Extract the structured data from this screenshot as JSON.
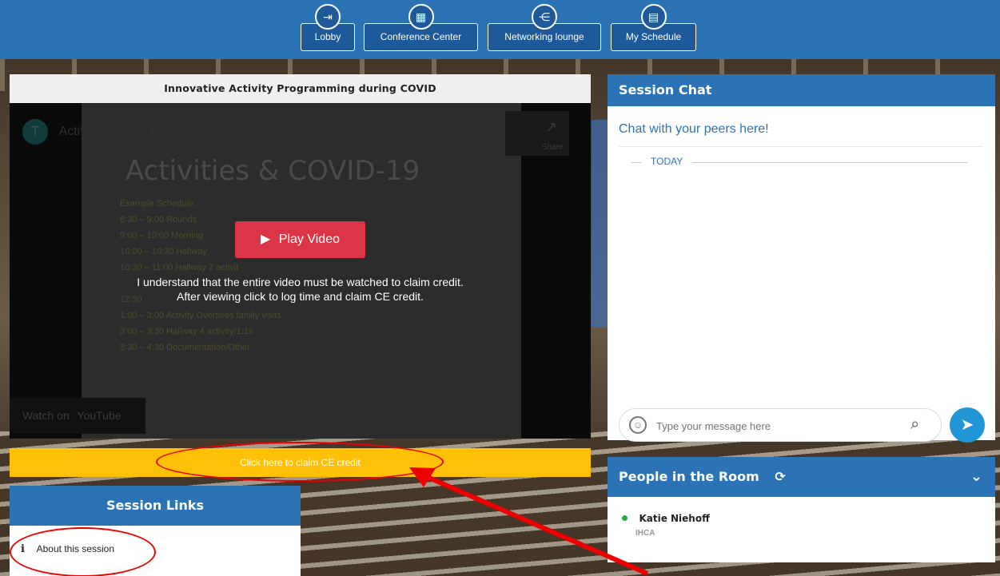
{
  "nav": {
    "items": [
      {
        "label": "Lobby",
        "icon": "sign-in-icon"
      },
      {
        "label": "Conference Center",
        "icon": "conference-icon"
      },
      {
        "label": "Networking lounge",
        "icon": "networking-icon"
      },
      {
        "label": "My Schedule",
        "icon": "calendar-icon"
      }
    ]
  },
  "video": {
    "title": "Innovative Activity Programming during COVID",
    "yt_channel_initial": "T",
    "yt_title": "ActivityAtPresentationNov2021",
    "watch_on": "Watch on",
    "youtube": "YouTube",
    "share": "Share",
    "slide_heading": "Activities & COVID-19",
    "slide_lines": [
      "Example Schedule:",
      "8:30 – 9:00 Rounds",
      "9:00 – 10:00 Morning",
      "10:00 – 10:30 Hallway",
      "10:30 – 11:00 Hallway 2 activit",
      "12:30",
      "1:00 – 3:00 Activity Oversees family visits",
      "3:00 – 3:30 Hallway 4 activity/1:1s",
      "3:30 – 4:30 Documentation/Other"
    ],
    "play_label": "Play Video",
    "understand_line1": "I understand that the entire video must be watched to claim credit.",
    "understand_line2": "After viewing click to log time and claim CE credit."
  },
  "claim": {
    "label": "Click here to claim CE credit"
  },
  "session_links": {
    "title": "Session Links",
    "items": [
      {
        "label": "About this session",
        "icon": "info-icon"
      }
    ]
  },
  "chat": {
    "title": "Session Chat",
    "subtitle": "Chat with your peers here!",
    "date_divider": "TODAY",
    "input_placeholder": "Type your message here"
  },
  "people": {
    "title": "People in the Room",
    "list": [
      {
        "name": "Katie Niehoff",
        "org": "IHCA",
        "status": "online"
      }
    ]
  },
  "colors": {
    "primary": "#2b73b4",
    "claim": "#ffc107",
    "play": "#dc3545",
    "send": "#2196d6",
    "annotation": "#ee0000"
  }
}
